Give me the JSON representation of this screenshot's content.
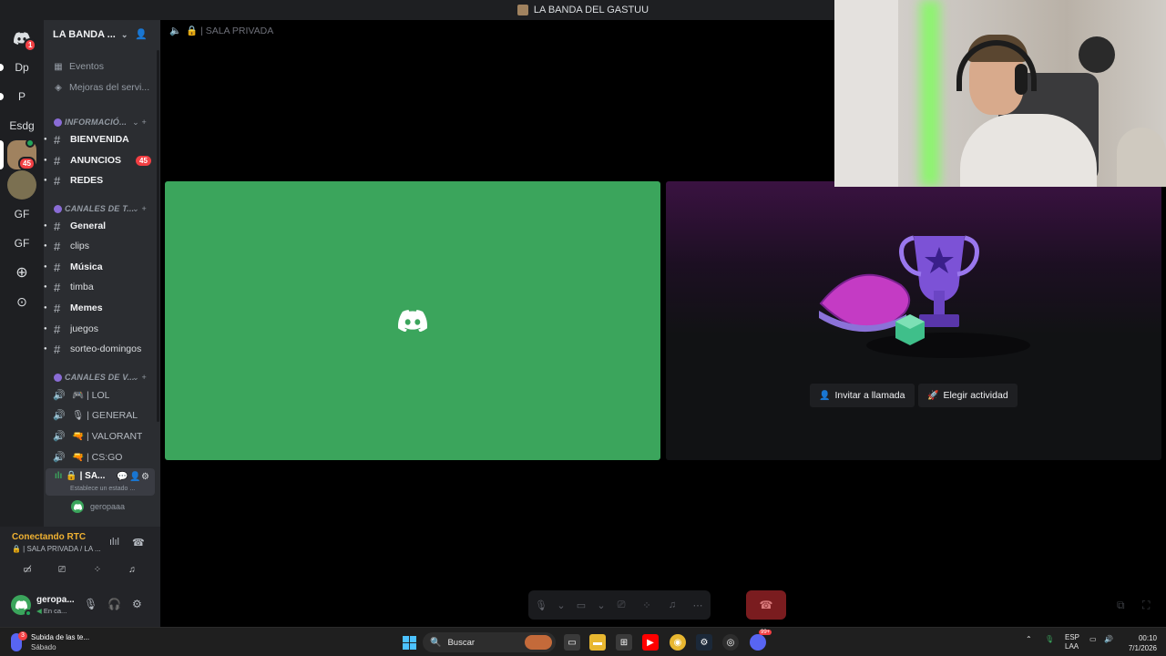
{
  "window": {
    "title": "LA BANDA DEL GASTUU"
  },
  "rail": {
    "home_badge": "1",
    "servers": [
      "Dp",
      "P",
      "Esdg",
      "GF",
      "GF"
    ],
    "server_badge": "45"
  },
  "sidebar": {
    "server_name": "LA BANDA ...",
    "events": [
      {
        "label": "Eventos",
        "icon": "calendar-icon"
      },
      {
        "label": "Mejoras del servi...",
        "icon": "boost-icon"
      }
    ],
    "categories": [
      "INFORMACIÓ...",
      "CANALES DE T...",
      "CANALES DE V..."
    ],
    "info_channels": [
      {
        "label": "BIENVENIDA",
        "bold": true
      },
      {
        "label": "ANUNCIOS",
        "bold": true,
        "count": "45"
      },
      {
        "label": "REDES",
        "bold": true
      }
    ],
    "text_channels": [
      {
        "label": "General",
        "bold": true
      },
      {
        "label": "clips",
        "bold": false
      },
      {
        "label": "Música",
        "bold": true
      },
      {
        "label": "timba",
        "bold": false
      },
      {
        "label": "Memes",
        "bold": true
      },
      {
        "label": "juegos",
        "bold": false
      },
      {
        "label": "sorteo-domingos",
        "bold": false
      }
    ],
    "voice_channels": [
      "🎮 | LOL",
      "🎙 | GENERAL",
      "🔫 | VALORANT",
      "🔫 | CS:GO"
    ],
    "active_channel": {
      "label": "🔒 | SA...",
      "status_placeholder": "Establece un estado ...",
      "user": "geropaaa"
    }
  },
  "voice_panel": {
    "status": "Conectando RTC",
    "channel": "🔒 | SALA PRIVADA / LA ..."
  },
  "user_panel": {
    "name": "geropa...",
    "status": "En ca..."
  },
  "call": {
    "header": "🔒 | SALA PRIVADA",
    "invite_label": "Invitar a llamada",
    "activity_label": "Elegir actividad"
  },
  "taskbar": {
    "notif_title": "Subida de las te...",
    "notif_sub": "Sábado",
    "notif_badge": "3",
    "search_placeholder": "Buscar",
    "lang_1": "ESP",
    "lang_2": "LAA",
    "time": "00:10",
    "date": "7/1/2026",
    "discord_badge": "99+"
  },
  "colors": {
    "accent_green": "#3ba55c",
    "blurple": "#5865f2",
    "danger": "#f23f43",
    "warning": "#f0b232"
  }
}
